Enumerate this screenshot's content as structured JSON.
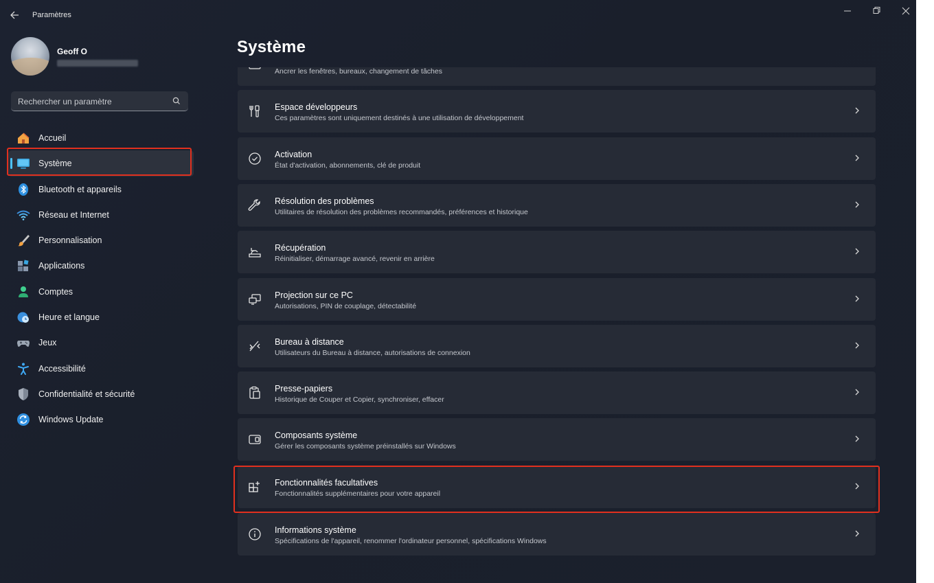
{
  "window": {
    "app_title": "Paramètres"
  },
  "profile": {
    "name": "Geoff O"
  },
  "search": {
    "placeholder": "Rechercher un paramètre"
  },
  "nav": [
    {
      "label": "Accueil",
      "icon": "home-icon"
    },
    {
      "label": "Système",
      "icon": "system-icon",
      "active": true
    },
    {
      "label": "Bluetooth et appareils",
      "icon": "bluetooth-icon"
    },
    {
      "label": "Réseau et Internet",
      "icon": "wifi-icon"
    },
    {
      "label": "Personnalisation",
      "icon": "brush-icon"
    },
    {
      "label": "Applications",
      "icon": "apps-icon"
    },
    {
      "label": "Comptes",
      "icon": "account-icon"
    },
    {
      "label": "Heure et langue",
      "icon": "clock-globe-icon"
    },
    {
      "label": "Jeux",
      "icon": "gamepad-icon"
    },
    {
      "label": "Accessibilité",
      "icon": "accessibility-icon"
    },
    {
      "label": "Confidentialité et sécurité",
      "icon": "shield-icon"
    },
    {
      "label": "Windows Update",
      "icon": "update-icon"
    }
  ],
  "page": {
    "title": "Système"
  },
  "items": [
    {
      "title": "",
      "subtitle": "Ancrer les fenêtres, bureaux, changement de tâches",
      "icon": "multitasking-icon"
    },
    {
      "title": "Espace développeurs",
      "subtitle": "Ces paramètres sont uniquement destinés à une utilisation de développement",
      "icon": "developer-tools-icon"
    },
    {
      "title": "Activation",
      "subtitle": "État d'activation, abonnements, clé de produit",
      "icon": "check-circle-icon"
    },
    {
      "title": "Résolution des problèmes",
      "subtitle": "Utilitaires de résolution des problèmes recommandés, préférences et historique",
      "icon": "wrench-icon"
    },
    {
      "title": "Récupération",
      "subtitle": "Réinitialiser, démarrage avancé, revenir en arrière",
      "icon": "recovery-icon"
    },
    {
      "title": "Projection sur ce PC",
      "subtitle": "Autorisations, PIN de couplage, détectabilité",
      "icon": "projection-icon"
    },
    {
      "title": "Bureau à distance",
      "subtitle": "Utilisateurs du Bureau à distance, autorisations de connexion",
      "icon": "remote-desktop-icon"
    },
    {
      "title": "Presse-papiers",
      "subtitle": "Historique de Couper et Copier, synchroniser, effacer",
      "icon": "clipboard-icon"
    },
    {
      "title": "Composants système",
      "subtitle": "Gérer les composants système préinstallés sur Windows",
      "icon": "components-icon"
    },
    {
      "title": "Fonctionnalités facultatives",
      "subtitle": "Fonctionnalités supplémentaires pour votre appareil",
      "icon": "add-apps-icon"
    },
    {
      "title": "Informations système",
      "subtitle": "Spécifications de l'appareil, renommer l'ordinateur personnel, spécifications Windows",
      "icon": "info-icon"
    }
  ],
  "colors": {
    "accent": "#4cc2ff",
    "highlight": "#e2301e",
    "card": "#262b36",
    "background": "#1c2230"
  }
}
